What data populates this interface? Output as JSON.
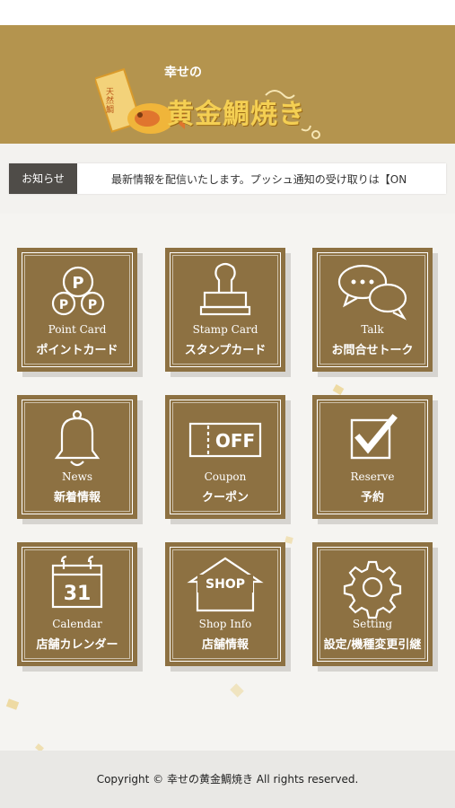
{
  "brand": {
    "logo_text": "幸せの黄金鯛焼き",
    "logo_tag": "天然鯛"
  },
  "notice": {
    "label": "お知らせ",
    "text": "最新情報を配信いたします。プッシュ通知の受け取りは【ON"
  },
  "menu": [
    {
      "en": "Point Card",
      "jp": "ポイントカード",
      "icon": "point-card-icon"
    },
    {
      "en": "Stamp Card",
      "jp": "スタンプカード",
      "icon": "stamp-icon"
    },
    {
      "en": "Talk",
      "jp": "お問合せトーク",
      "icon": "chat-bubbles-icon"
    },
    {
      "en": "News",
      "jp": "新着情報",
      "icon": "bell-icon"
    },
    {
      "en": "Coupon",
      "jp": "クーポン",
      "icon": "coupon-icon",
      "icon_text": "OFF"
    },
    {
      "en": "Reserve",
      "jp": "予約",
      "icon": "checkbox-icon"
    },
    {
      "en": "Calendar",
      "jp": "店舗カレンダー",
      "icon": "calendar-icon",
      "icon_text": "31"
    },
    {
      "en": "Shop Info",
      "jp": "店舗情報",
      "icon": "shop-icon",
      "icon_text": "SHOP"
    },
    {
      "en": "Setting",
      "jp": "設定/機種変更引継",
      "icon": "gear-icon"
    }
  ],
  "footer": {
    "copyright": "Copyright © 幸せの黄金鯛焼き All rights reserved."
  },
  "colors": {
    "header": "#b4944e",
    "tile": "#8d7142",
    "notice_label": "#4f4c48"
  }
}
